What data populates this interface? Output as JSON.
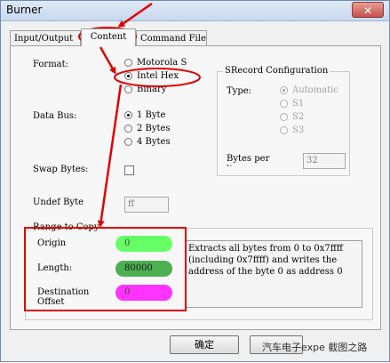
{
  "window": {
    "title": "Burner",
    "close_label": "✕"
  },
  "tabs": [
    {
      "label": "Input/Output"
    },
    {
      "label": "Content"
    },
    {
      "label": "Command File"
    }
  ],
  "format": {
    "label": "Format:",
    "options": [
      "Motorola S",
      "Intel Hex",
      "Binary"
    ],
    "selected": "Intel Hex"
  },
  "srecord": {
    "title": "SRecord Configuration",
    "type_label": "Type:",
    "options": [
      "Automatic",
      "S1",
      "S2",
      "S3"
    ],
    "selected": "Automatic",
    "bytes_label": "Bytes per line:",
    "bytes_value": "32"
  },
  "data_bus": {
    "label": "Data Bus:",
    "options": [
      "1 Byte",
      "2 Bytes",
      "4 Bytes"
    ],
    "selected": "1 Byte"
  },
  "swap_bytes": {
    "label": "Swap Bytes:"
  },
  "undef_byte": {
    "label": "Undef Byte",
    "value": "ff"
  },
  "range": {
    "title": "Range to Copy",
    "origin_label": "Origin",
    "origin_value": "0",
    "length_label": "Length:",
    "length_value": "80000",
    "dest_label": "Destination Offset",
    "dest_value": "0",
    "description": "Extracts all bytes from 0 to 0x7ffff (including 0x7ffff) and writes the address of the byte 0 as address 0"
  },
  "footer": {
    "ok_label": "确定",
    "watermark": "汽车电子expe 截图之路"
  },
  "colors": {
    "annotation": "#e00000",
    "origin_fill": "#66ff66",
    "length_fill": "#4caf50",
    "dest_fill": "#ff33ff"
  }
}
